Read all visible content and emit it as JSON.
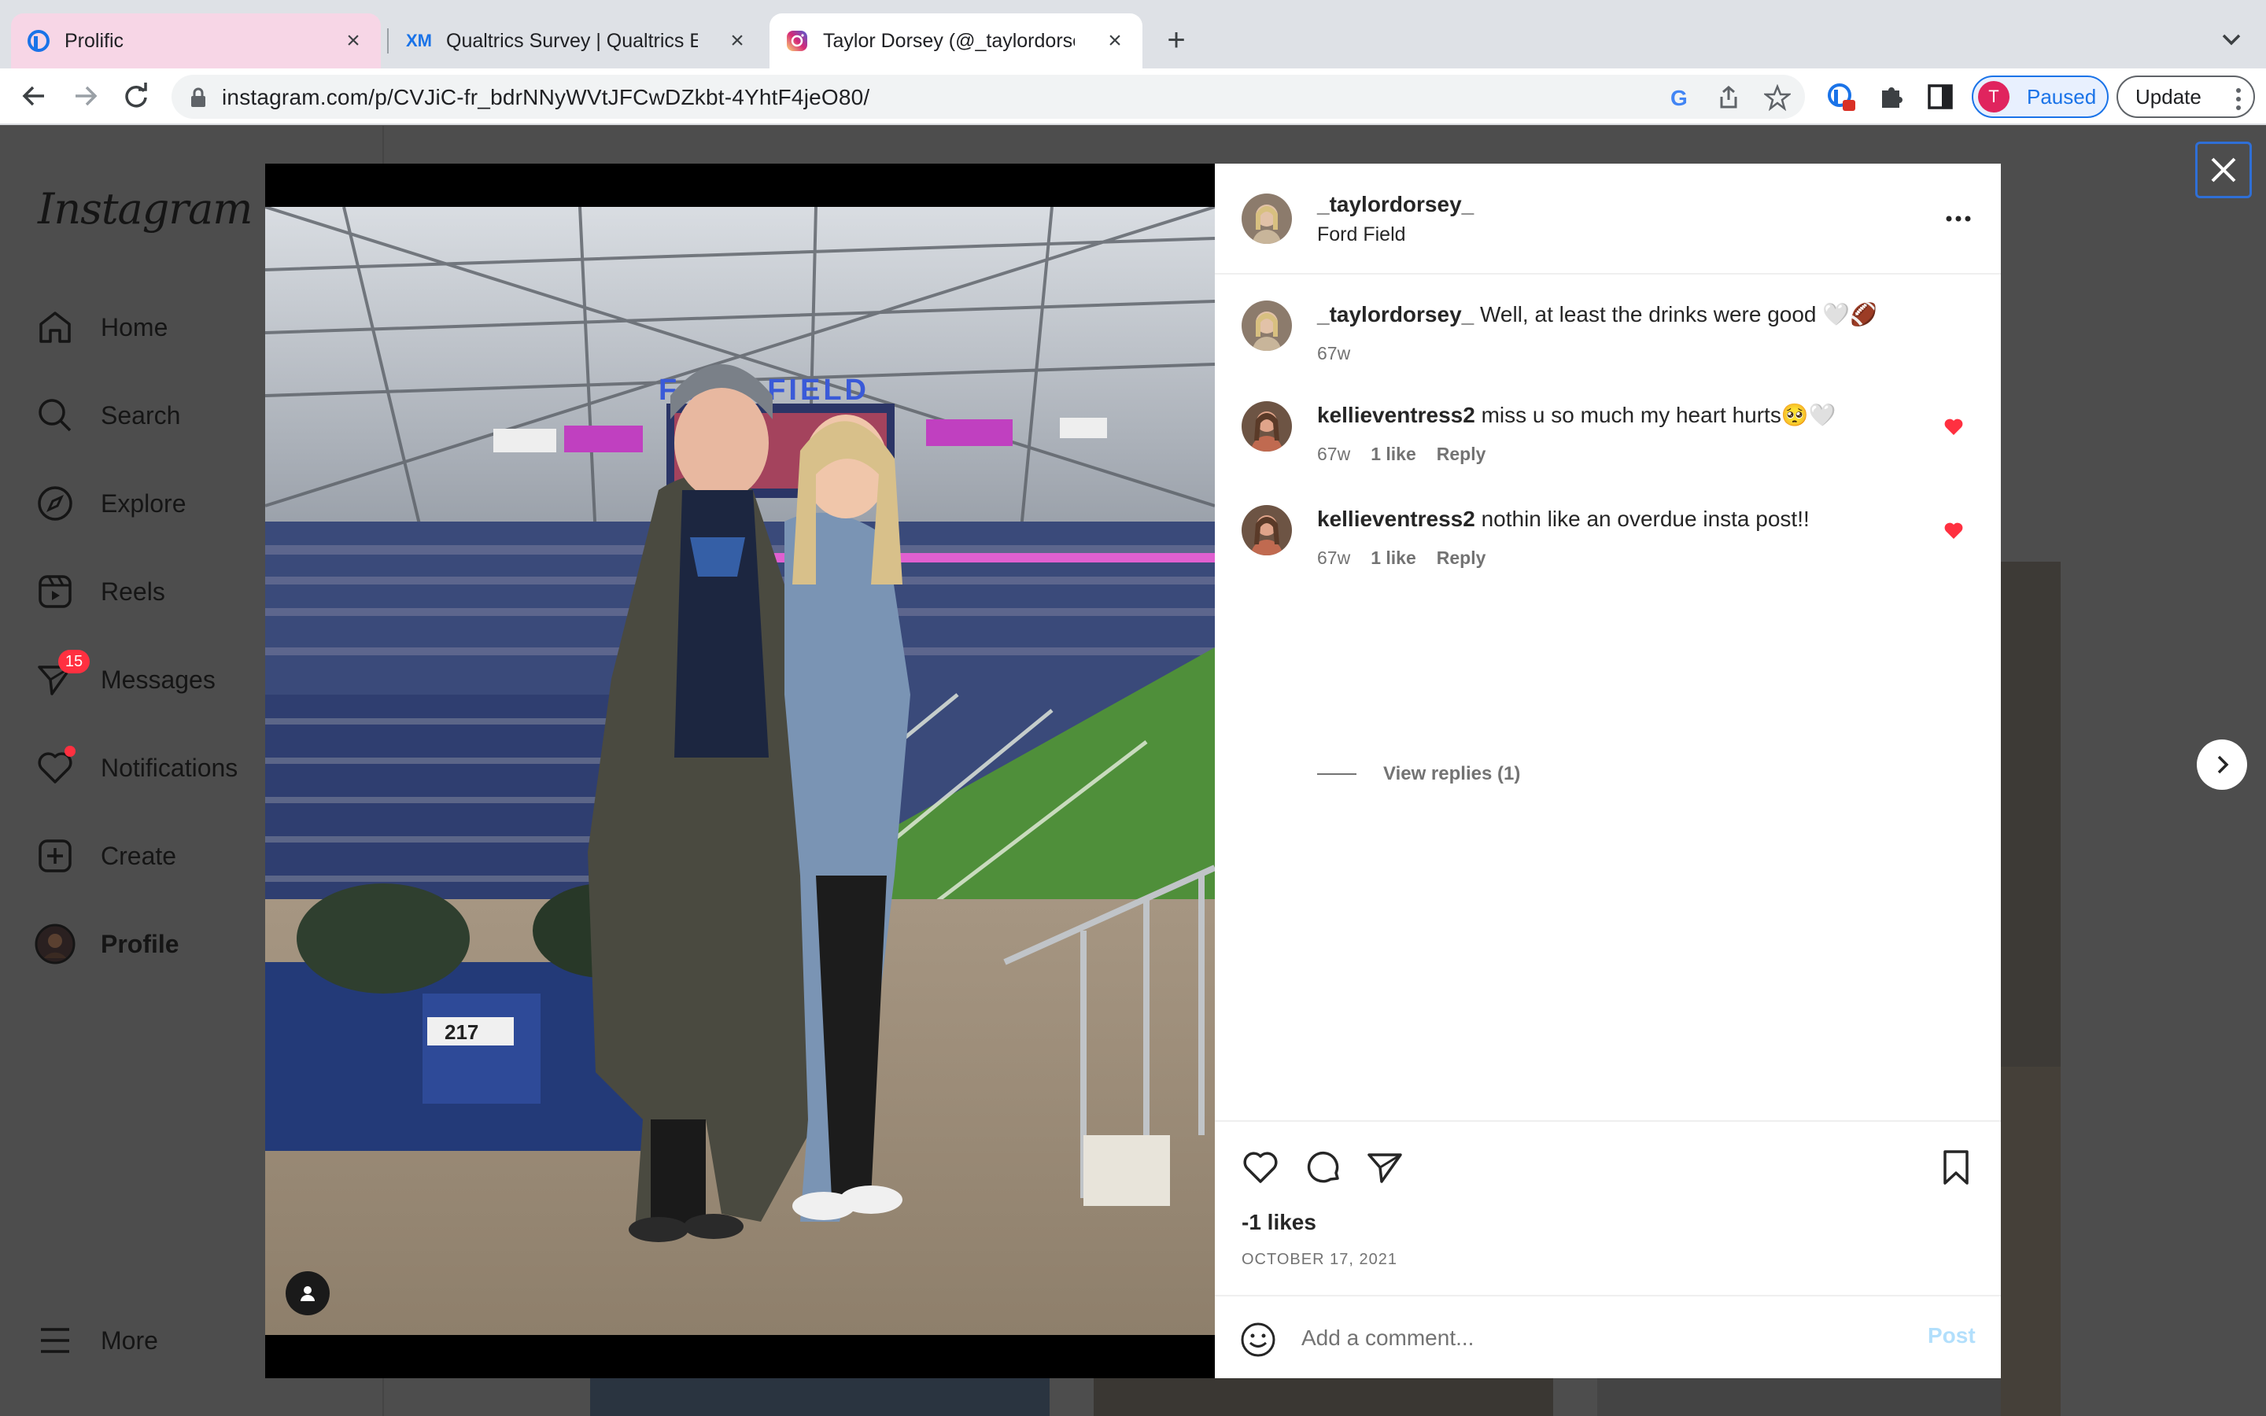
{
  "browser": {
    "tabs": [
      {
        "title": "Prolific"
      },
      {
        "title": "Qualtrics Survey | Qualtrics Exp"
      },
      {
        "title": "Taylor Dorsey (@_taylordorsey_"
      }
    ],
    "url": "instagram.com/p/CVJiC-fr_bdrNNyWVtJFCwDZkbt-4YhtF4jeO80/",
    "profile_initial": "T",
    "profile_label": "Paused",
    "update_label": "Update",
    "accent": "#1a73e8"
  },
  "instagram": {
    "logo": "Instagram",
    "nav": [
      {
        "label": "Home",
        "icon": "home-icon"
      },
      {
        "label": "Search",
        "icon": "search-icon"
      },
      {
        "label": "Explore",
        "icon": "compass-icon"
      },
      {
        "label": "Reels",
        "icon": "reels-icon"
      },
      {
        "label": "Messages",
        "icon": "messenger-icon",
        "badge": "15"
      },
      {
        "label": "Notifications",
        "icon": "heart-icon"
      },
      {
        "label": "Create",
        "icon": "plus-square-icon"
      },
      {
        "label": "Profile",
        "icon": "avatar"
      },
      {
        "label": "More",
        "icon": "menu-icon"
      }
    ]
  },
  "post": {
    "username": "_taylordorsey_",
    "location": "Ford Field",
    "caption": {
      "username": "_taylordorsey_",
      "text": "Well, at least the drinks were good 🤍🏈",
      "age": "67w"
    },
    "comments": [
      {
        "username": "kellieventress2",
        "text": "miss u so much my heart hurts🥺🤍",
        "age": "67w",
        "likes": "1 like",
        "reply": "Reply"
      },
      {
        "username": "kellieventress2",
        "text": "nothin like an overdue insta post!!",
        "age": "67w",
        "likes": "1 like",
        "reply": "Reply"
      }
    ],
    "view_replies": "View replies (1)",
    "likes": "-1 likes",
    "date": "OCTOBER 17, 2021",
    "comment_placeholder": "Add a comment...",
    "post_label": "Post",
    "photo_signs": {
      "stadium": "FORD FIELD",
      "seat": "217"
    },
    "like_color": "#ff3040"
  }
}
